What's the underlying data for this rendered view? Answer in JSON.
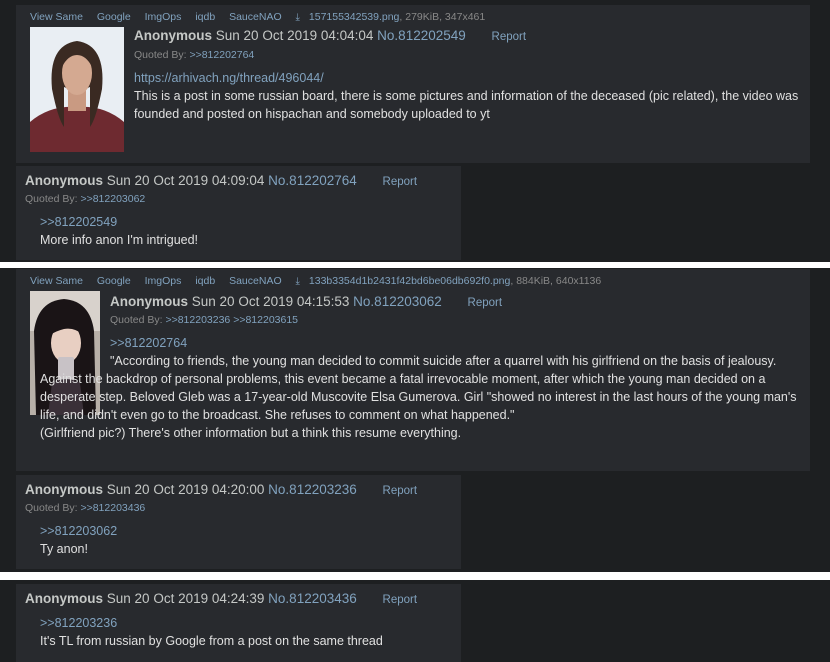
{
  "file_links": [
    "View Same",
    "Google",
    "ImgOps",
    "iqdb",
    "SauceNAO"
  ],
  "post1": {
    "filename": "157155342539.png",
    "filemeta": ", 279KiB, 347x461",
    "name": "Anonymous",
    "date": "Sun 20 Oct 2019 04:04:04",
    "number": "No.812202549",
    "report": "Report",
    "quoted_by_label": "Quoted By:",
    "quoted_by": [
      ">>812202764"
    ],
    "url": "https://arhivach.ng/thread/496044/",
    "text": "This is a post in some russian board, there is some pictures and information of the deceased (pic related), the video was founded and posted on hispachan and somebody uploaded to yt"
  },
  "post2": {
    "name": "Anonymous",
    "date": "Sun 20 Oct 2019 04:09:04",
    "number": "No.812202764",
    "report": "Report",
    "quoted_by_label": "Quoted By:",
    "quoted_by": [
      ">>812203062"
    ],
    "quote": ">>812202549",
    "text": "More info anon I'm intrigued!"
  },
  "post3": {
    "filename": "133b3354d1b2431f42bd6be06db692f0.png",
    "filemeta": ", 884KiB, 640x1136",
    "name": "Anonymous",
    "date": "Sun 20 Oct 2019 04:15:53",
    "number": "No.812203062",
    "report": "Report",
    "quoted_by_label": "Quoted By:",
    "quoted_by": [
      ">>812203236",
      ">>812203615"
    ],
    "quote": ">>812202764",
    "text": "\"According to friends, the young man decided to commit suicide after a quarrel with his girlfriend on the basis of jealousy. Against the backdrop of personal problems, this event became a fatal irrevocable moment, after which the young man decided on a desperate step. Beloved Gleb was a 17-year-old Muscovite Elsa Gumerova. Girl \"showed no interest in the last hours of the young man's life, and didn't even go to the broadcast. She refuses to comment on what happened.\"",
    "text2": "(Girlfriend pic?) There's other information but a think this resume everything."
  },
  "post4": {
    "name": "Anonymous",
    "date": "Sun 20 Oct 2019 04:20:00",
    "number": "No.812203236",
    "report": "Report",
    "quoted_by_label": "Quoted By:",
    "quoted_by": [
      ">>812203436"
    ],
    "quote": ">>812203062",
    "text": "Ty anon!"
  },
  "post5": {
    "name": "Anonymous",
    "date": "Sun 20 Oct 2019 04:24:39",
    "number": "No.812203436",
    "report": "Report",
    "quote": ">>812203236",
    "text": "It's TL from russian by Google from a post on the same thread"
  },
  "colors": {
    "background": "#1d1f21",
    "post_background": "#282a2e",
    "link": "#81a2be",
    "text": "#c5c8c6"
  }
}
